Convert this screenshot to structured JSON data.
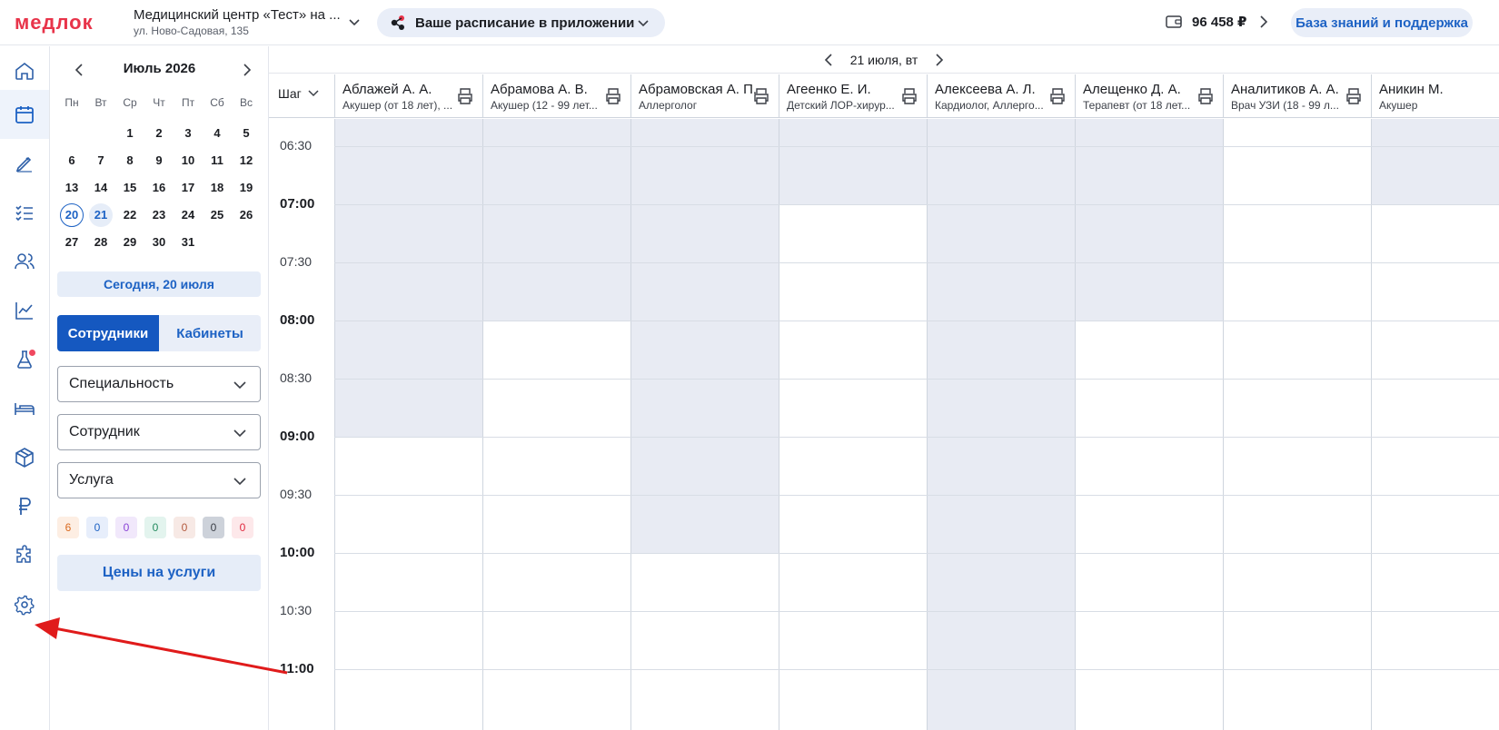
{
  "header": {
    "logo": "медлок",
    "clinic_name": "Медицинский центр «Тест» на ...",
    "clinic_address": "ул. Ново-Садовая, 135",
    "app_promo": "Ваше расписание в приложении",
    "balance": "96 458 ₽",
    "kb_button": "База знаний и поддержка"
  },
  "rail": {
    "items": [
      {
        "icon": "home-icon"
      },
      {
        "icon": "calendar-icon",
        "active": true
      },
      {
        "icon": "pen-icon"
      },
      {
        "icon": "checklist-icon"
      },
      {
        "icon": "users-icon"
      },
      {
        "icon": "chart-icon"
      },
      {
        "icon": "flask-icon",
        "badge": true
      },
      {
        "icon": "bed-icon"
      },
      {
        "icon": "box-icon"
      },
      {
        "icon": "ruble-icon"
      },
      {
        "icon": "puzzle-icon"
      },
      {
        "icon": "gear-icon"
      }
    ]
  },
  "calendar": {
    "month": "Июль 2026",
    "weekdays": [
      "Пн",
      "Вт",
      "Ср",
      "Чт",
      "Пт",
      "Сб",
      "Вс"
    ],
    "weeks": [
      [
        "",
        "",
        "1",
        "2",
        "3",
        "4",
        "5"
      ],
      [
        "6",
        "7",
        "8",
        "9",
        "10",
        "11",
        "12"
      ],
      [
        "13",
        "14",
        "15",
        "16",
        "17",
        "18",
        "19"
      ],
      [
        "20",
        "21",
        "22",
        "23",
        "24",
        "25",
        "26"
      ],
      [
        "27",
        "28",
        "29",
        "30",
        "31",
        "",
        ""
      ]
    ],
    "today": "20",
    "selected": "21",
    "today_button": "Сегодня, 20 июля"
  },
  "tabs": {
    "employees": "Сотрудники",
    "rooms": "Кабинеты"
  },
  "filters": {
    "specialty": "Специальность",
    "employee": "Сотрудник",
    "service": "Услуга"
  },
  "status_chips": [
    {
      "value": "0",
      "bg": "#fdeee3",
      "fg": "#d9691e"
    },
    {
      "value": "0",
      "bg": "#e7eefb",
      "fg": "#1d62c4"
    },
    {
      "value": "0",
      "bg": "#f1e8fb",
      "fg": "#8a43d6"
    },
    {
      "value": "0",
      "bg": "#e3f4ee",
      "fg": "#238a5e"
    },
    {
      "value": "0",
      "bg": "#f7e9e5",
      "fg": "#b35a3e"
    },
    {
      "value": "0",
      "bg": "#cdd2da",
      "fg": "#3b3f47"
    },
    {
      "value": "0",
      "bg": "#fde8ea",
      "fg": "#e0293f"
    }
  ],
  "first_chip": "6",
  "prices_button": "Цены на услуги",
  "schedule": {
    "date": "21 июля, вт",
    "step_label": "Шаг",
    "columns": [
      {
        "name": "Аблажей А. А.",
        "spec": "Акушер (от 18 лет), ..."
      },
      {
        "name": "Абрамова А. В.",
        "spec": "Акушер (12 - 99 лет..."
      },
      {
        "name": "Абрамовская А. П.",
        "spec": "Аллерголог"
      },
      {
        "name": "Агеенко Е. И.",
        "spec": "Детский ЛОР-хирур..."
      },
      {
        "name": "Алексеева А. Л.",
        "spec": "Кардиолог, Аллерго..."
      },
      {
        "name": "Алещенко Д. А.",
        "spec": "Терапевт (от 18 лет..."
      },
      {
        "name": "Аналитиков А. А.",
        "spec": "Врач УЗИ (18 - 99 л..."
      },
      {
        "name": "Аникин М.",
        "spec": "Акушер"
      }
    ],
    "times": [
      "06:30",
      "07:00",
      "07:30",
      "08:00",
      "08:30",
      "09:00",
      "09:30",
      "10:00",
      "10:30",
      "11:00"
    ],
    "unavailable_until": [
      "09:00",
      "08:00",
      "10:00",
      "07:00",
      "end",
      "08:00",
      "none",
      "07:00"
    ],
    "unavailable_from": [
      "",
      "",
      "",
      "",
      "",
      "",
      "",
      ""
    ]
  },
  "colors": {
    "accent": "#1d62c4",
    "brand": "#e8344a",
    "unavailable": "#e8ebf3",
    "annotation": "#e01b1b"
  }
}
